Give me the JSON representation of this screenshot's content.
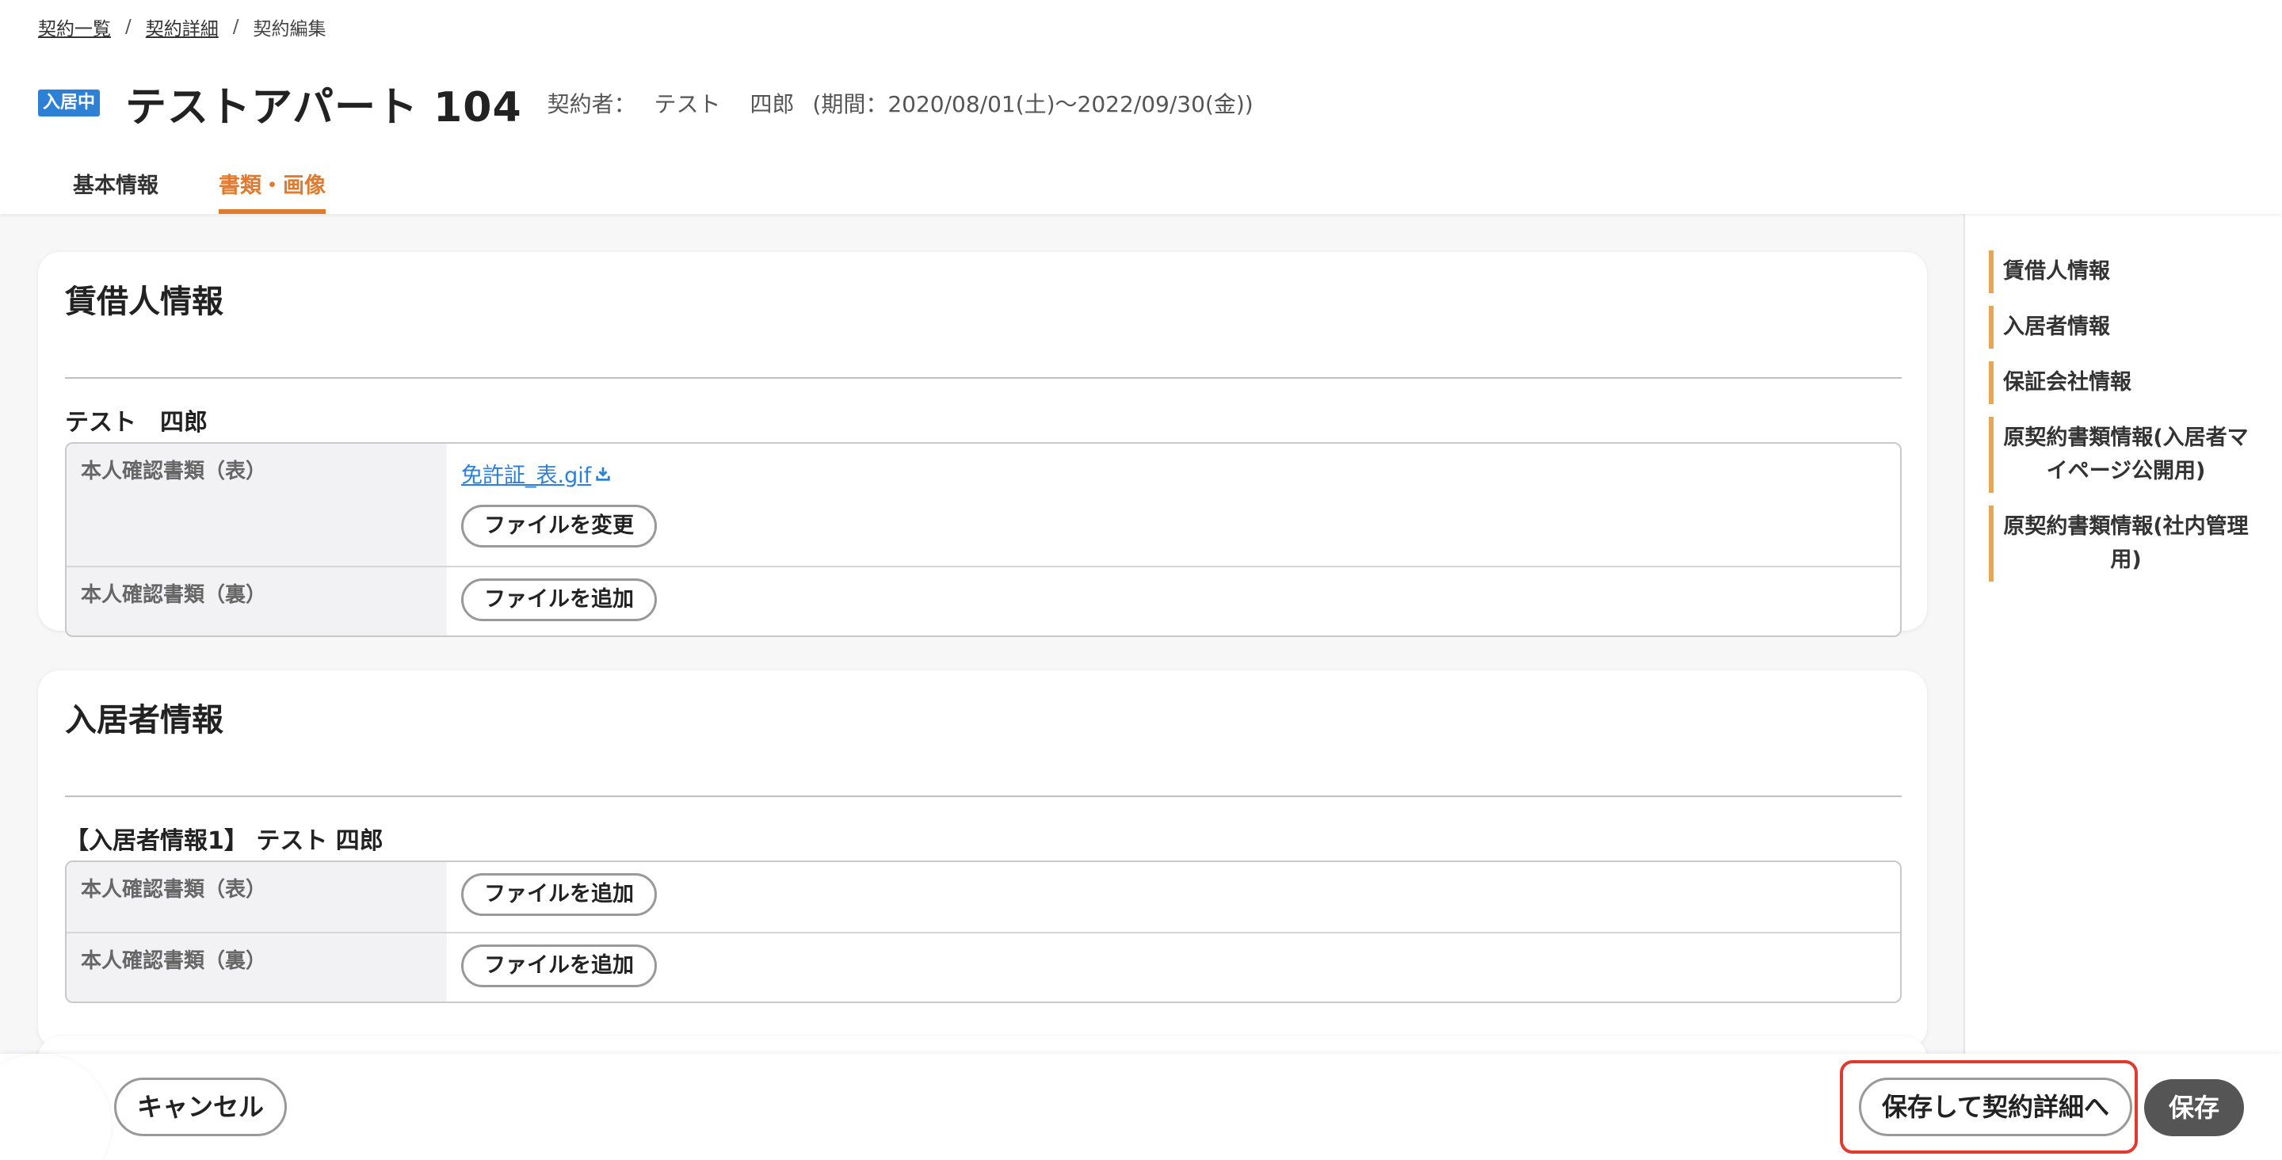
{
  "breadcrumb": {
    "items": [
      "契約一覧",
      "契約詳細"
    ],
    "current": "契約編集",
    "separator": "/"
  },
  "header": {
    "status_badge": "入居中",
    "title": "テストアパート 104",
    "contractor_label": "契約者：",
    "contractor_first": "テスト",
    "contractor_last": "四郎",
    "period": "(期間：2020/08/01(土)〜2022/09/30(金))"
  },
  "tabs": [
    {
      "label": "基本情報",
      "active": false
    },
    {
      "label": "書類・画像",
      "active": true
    }
  ],
  "sections": {
    "lessee": {
      "title": "賃借人情報",
      "person": "テスト　四郎",
      "rows": [
        {
          "label": "本人確認書類（表）",
          "file": "免許証_表.gif",
          "button": "ファイルを変更"
        },
        {
          "label": "本人確認書類（裏）",
          "button": "ファイルを追加"
        }
      ]
    },
    "resident": {
      "title": "入居者情報",
      "person": "【入居者情報1】 テスト 四郎",
      "rows": [
        {
          "label": "本人確認書類（表）",
          "button": "ファイルを追加"
        },
        {
          "label": "本人確認書類（裏）",
          "button": "ファイルを追加"
        }
      ]
    }
  },
  "side_nav": {
    "items": [
      "賃借人情報",
      "入居者情報",
      "保証会社情報",
      "原契約書類情報(入居者マイページ公開用)",
      "原契約書類情報(社内管理用)"
    ]
  },
  "footer": {
    "cancel_label": "キャンセル",
    "save_and_detail_label": "保存して契約詳細へ",
    "save_label": "保存"
  },
  "colors": {
    "accent": "#e07a2e",
    "badge": "#2e7fd6",
    "link": "#2e7fd6",
    "nav_bar": "#e8a654",
    "highlight": "#e03a2e",
    "save_button": "#555555"
  }
}
